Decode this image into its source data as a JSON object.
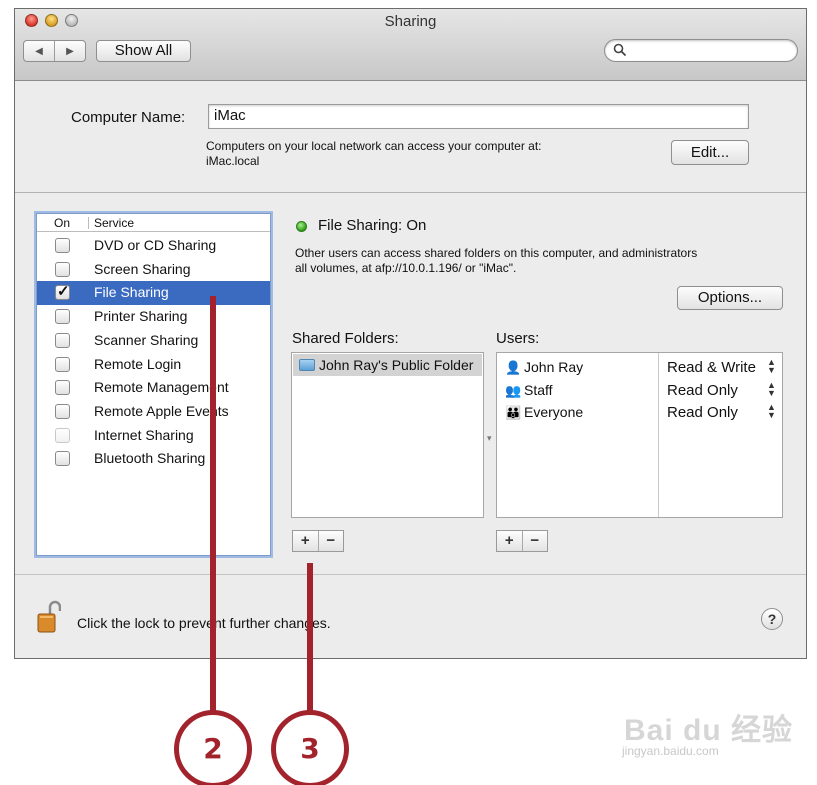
{
  "window": {
    "title": "Sharing"
  },
  "toolbar": {
    "back": "◀",
    "forward": "▶",
    "show_all": "Show All",
    "search_placeholder": ""
  },
  "computer_name": {
    "label": "Computer Name:",
    "value": "iMac",
    "description_line1": "Computers on your local network can access your computer at:",
    "description_line2": "iMac.local",
    "edit_button": "Edit..."
  },
  "services": {
    "header_on": "On",
    "header_service": "Service",
    "items": [
      {
        "label": "DVD or CD Sharing",
        "checked": false,
        "selected": false
      },
      {
        "label": "Screen Sharing",
        "checked": false,
        "selected": false
      },
      {
        "label": "File Sharing",
        "checked": true,
        "selected": true
      },
      {
        "label": "Printer Sharing",
        "checked": false,
        "selected": false
      },
      {
        "label": "Scanner Sharing",
        "checked": false,
        "selected": false
      },
      {
        "label": "Remote Login",
        "checked": false,
        "selected": false
      },
      {
        "label": "Remote Management",
        "checked": false,
        "selected": false
      },
      {
        "label": "Remote Apple Events",
        "checked": false,
        "selected": false
      },
      {
        "label": "Internet Sharing",
        "checked": false,
        "selected": false,
        "disabled": true
      },
      {
        "label": "Bluetooth Sharing",
        "checked": false,
        "selected": false
      }
    ]
  },
  "status": {
    "text": "File Sharing: On",
    "color": "#3cb023",
    "description_line1": "Other users can access shared folders on this computer, and administrators",
    "description_line2": "all volumes, at afp://10.0.1.196/ or \"iMac\".",
    "options_button": "Options..."
  },
  "shared_folders": {
    "label": "Shared Folders:",
    "items": [
      "John Ray's Public Folder"
    ],
    "add": "+",
    "remove": "−"
  },
  "users": {
    "label": "Users:",
    "items": [
      {
        "name": "John Ray",
        "permission": "Read & Write",
        "icon": "person-icon"
      },
      {
        "name": "Staff",
        "permission": "Read Only",
        "icon": "group-icon"
      },
      {
        "name": "Everyone",
        "permission": "Read Only",
        "icon": "everyone-icon"
      }
    ],
    "add": "+",
    "remove": "−"
  },
  "footer": {
    "lock_text": "Click the lock to prevent further changes.",
    "help": "?"
  },
  "callouts": [
    "2",
    "3"
  ],
  "watermark": {
    "logo": "Bai du 经验",
    "url": "jingyan.baidu.com"
  },
  "colors": {
    "selection": "#3a6bc1",
    "callout": "#a3232c"
  }
}
